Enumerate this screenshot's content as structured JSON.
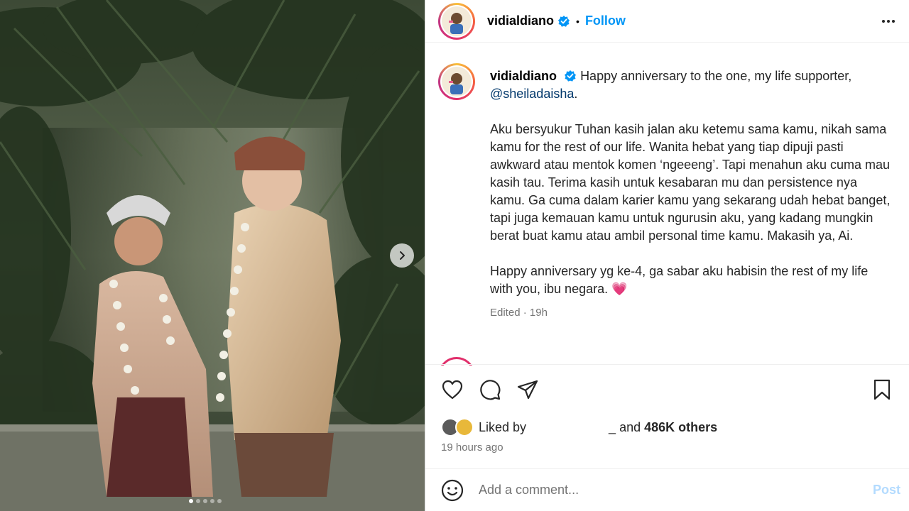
{
  "header": {
    "username": "vidialdiano",
    "separator": "•",
    "follow_label": "Follow",
    "more_icon": "more-horizontal-icon"
  },
  "caption": {
    "username": "vidialdiano",
    "line1": "Happy anniversary to the one, my life supporter,",
    "mention": "@sheiladaisha",
    "mention_suffix": ".",
    "paragraph2": "Aku bersyukur Tuhan kasih jalan aku ketemu sama kamu, nikah sama kamu for the rest of our life. Wanita hebat yang tiap dipuji pasti awkward atau mentok komen ‘ngeeeng’. Tapi menahun aku cuma mau kasih tau. Terima kasih untuk kesabaran mu dan persistence nya kamu. Ga cuma dalam karier kamu yang sekarang udah hebat banget, tapi juga kemauan kamu untuk ngurusin aku, yang kadang mungkin berat buat kamu atau ambil personal time kamu. Makasih ya, Ai.",
    "paragraph3": "Happy anniversary yg ke-4, ga sabar aku habisin the rest of my life with you, ibu negara.",
    "emoji": "💗",
    "edited": "Edited",
    "dot": "·",
    "time": "19h"
  },
  "actions": {
    "like_icon": "heart-icon",
    "comment_icon": "comment-icon",
    "share_icon": "share-icon",
    "save_icon": "bookmark-icon"
  },
  "likes": {
    "prefix": "Liked by",
    "trailing": "_",
    "and": "and",
    "others": "486K others"
  },
  "timestamp": "19 hours ago",
  "comment": {
    "placeholder": "Add a comment...",
    "post_label": "Post",
    "emoji_icon": "smiley-icon"
  },
  "media": {
    "slide_count": 5,
    "active_slide": 1,
    "next_icon": "chevron-right-icon"
  },
  "colors": {
    "accent": "#0095f6",
    "post_disabled": "#b3dbff",
    "mention": "#00376b",
    "meta": "#737373",
    "heart_emoji": "#e8457a"
  }
}
